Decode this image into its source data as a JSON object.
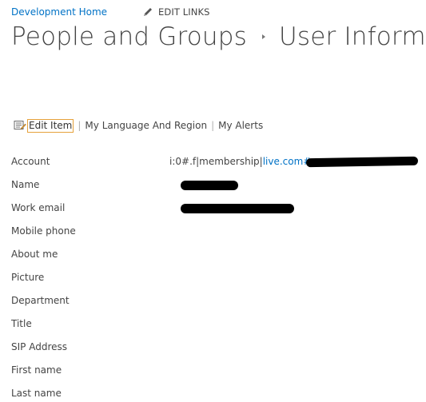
{
  "nav": {
    "home_link": "Development Home",
    "edit_links": "EDIT LINKS"
  },
  "title": {
    "part1": "People and Groups",
    "part2": "User Informa"
  },
  "toolbar": {
    "edit_item": "Edit Item",
    "separator": "|",
    "my_language": "My Language And Region",
    "my_alerts": "My Alerts"
  },
  "fields": [
    {
      "label": "Account"
    },
    {
      "label": "Name"
    },
    {
      "label": "Work email"
    },
    {
      "label": "Mobile phone"
    },
    {
      "label": "About me"
    },
    {
      "label": "Picture"
    },
    {
      "label": "Department"
    },
    {
      "label": "Title"
    },
    {
      "label": "SIP Address"
    },
    {
      "label": "First name"
    },
    {
      "label": "Last name"
    }
  ],
  "account": {
    "prefix": "i:0#.f|membership|",
    "link": "live.com#"
  },
  "colors": {
    "link": "#0072c6",
    "text": "#444444",
    "focus_border": "#e6a23c"
  },
  "icons": {
    "edit_links": "pencil-icon",
    "title_separator": "chevron-right-icon",
    "edit_item": "edit-form-icon"
  }
}
